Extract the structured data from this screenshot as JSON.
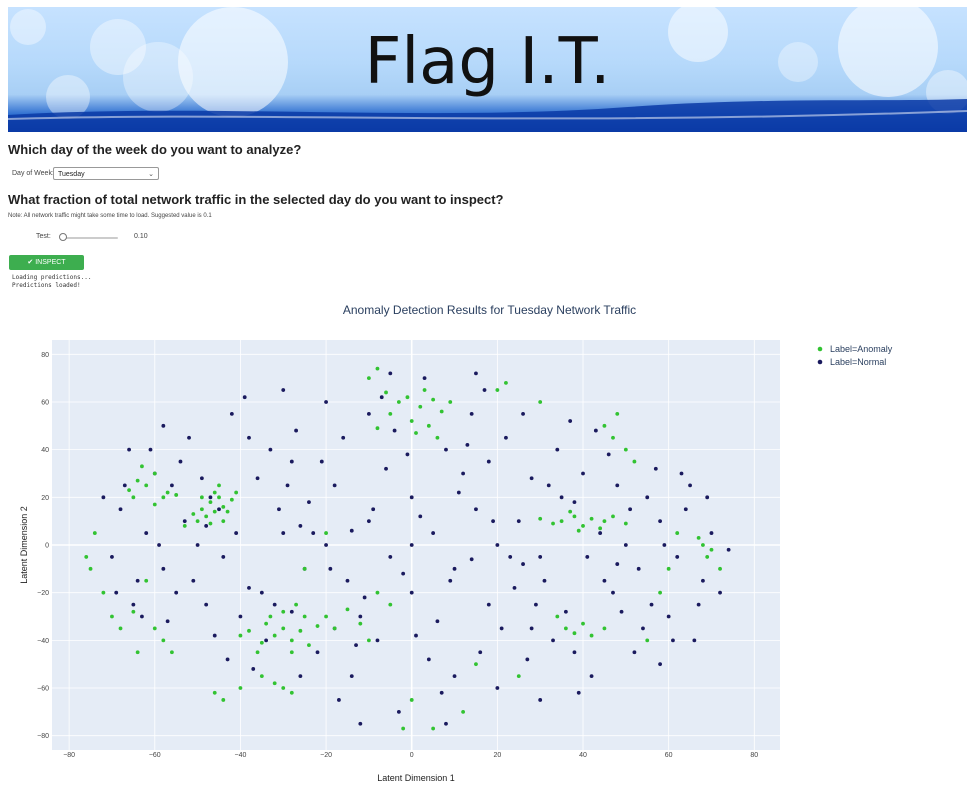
{
  "banner": {
    "title": "Flag I.T."
  },
  "form": {
    "day_question": "Which day of the week do you want to analyze?",
    "day_label": "Day of Week:",
    "day_value": "Tuesday",
    "fraction_question": "What fraction of total network traffic in the selected day do you want to inspect?",
    "note": "Note: All network traffic might take some time to load. Suggested value is 0.1",
    "slider_label": "Test:",
    "slider_value": "0.10",
    "slider_fraction": 0.1,
    "inspect_label": "INSPECT",
    "log": [
      "Loading predictions...",
      "Predictions loaded!"
    ]
  },
  "colors": {
    "anomaly": "#32c332",
    "normal": "#1a1a5e",
    "plot_bg": "#e5ecf6",
    "button": "#3dae4f"
  },
  "chart_data": {
    "type": "scatter",
    "title": "Anomaly Detection Results for Tuesday Network Traffic",
    "xlabel": "Latent Dimension 1",
    "ylabel": "Latent Dimension 2",
    "xlim": [
      -84,
      86
    ],
    "ylim": [
      -86,
      86
    ],
    "xticks": [
      "−80",
      "−60",
      "−40",
      "−20",
      "0",
      "20",
      "40",
      "60",
      "80"
    ],
    "yticks": [
      "80",
      "60",
      "40",
      "20",
      "0",
      "−20",
      "−40",
      "−60",
      "−80"
    ],
    "legend": "top-right",
    "series": [
      {
        "name": "Label=Anomaly",
        "color": "#32c332",
        "points": [
          [
            -45,
            20
          ],
          [
            -47,
            18
          ],
          [
            -49,
            15
          ],
          [
            -44,
            16
          ],
          [
            -46,
            22
          ],
          [
            -48,
            12
          ],
          [
            -50,
            10
          ],
          [
            -43,
            14
          ],
          [
            -45,
            25
          ],
          [
            -47,
            9
          ],
          [
            -51,
            13
          ],
          [
            -42,
            19
          ],
          [
            -44,
            10
          ],
          [
            -49,
            20
          ],
          [
            -46,
            14
          ],
          [
            -53,
            8
          ],
          [
            -41,
            22
          ],
          [
            -58,
            20
          ],
          [
            -60,
            17
          ],
          [
            -57,
            22
          ],
          [
            -62,
            25
          ],
          [
            -64,
            27
          ],
          [
            -60,
            30
          ],
          [
            -66,
            23
          ],
          [
            -63,
            33
          ],
          [
            -65,
            20
          ],
          [
            -55,
            21
          ],
          [
            -30,
            -35
          ],
          [
            -32,
            -38
          ],
          [
            -28,
            -40
          ],
          [
            -34,
            -33
          ],
          [
            -26,
            -36
          ],
          [
            -35,
            -41
          ],
          [
            -25,
            -30
          ],
          [
            -22,
            -34
          ],
          [
            -38,
            -36
          ],
          [
            -30,
            -28
          ],
          [
            -20,
            -30
          ],
          [
            -18,
            -35
          ],
          [
            -36,
            -45
          ],
          [
            -28,
            -45
          ],
          [
            -24,
            -42
          ],
          [
            -40,
            -38
          ],
          [
            -15,
            -27
          ],
          [
            -12,
            -33
          ],
          [
            -33,
            -30
          ],
          [
            -27,
            -25
          ],
          [
            -10,
            -40
          ],
          [
            -5,
            -25
          ],
          [
            -30,
            -60
          ],
          [
            -28,
            -62
          ],
          [
            -32,
            -58
          ],
          [
            -3,
            60
          ],
          [
            -1,
            62
          ],
          [
            2,
            58
          ],
          [
            5,
            61
          ],
          [
            -5,
            55
          ],
          [
            0,
            52
          ],
          [
            4,
            50
          ],
          [
            7,
            56
          ],
          [
            1,
            47
          ],
          [
            -6,
            64
          ],
          [
            9,
            60
          ],
          [
            3,
            65
          ],
          [
            -8,
            49
          ],
          [
            6,
            45
          ],
          [
            35,
            10
          ],
          [
            38,
            12
          ],
          [
            40,
            8
          ],
          [
            42,
            11
          ],
          [
            45,
            10
          ],
          [
            37,
            14
          ],
          [
            33,
            9
          ],
          [
            44,
            7
          ],
          [
            47,
            12
          ],
          [
            30,
            11
          ],
          [
            39,
            6
          ],
          [
            50,
            9
          ],
          [
            36,
            -35
          ],
          [
            38,
            -37
          ],
          [
            40,
            -33
          ],
          [
            42,
            -38
          ],
          [
            34,
            -30
          ],
          [
            45,
            -35
          ],
          [
            68,
            0
          ],
          [
            70,
            -2
          ],
          [
            67,
            3
          ],
          [
            69,
            -5
          ],
          [
            72,
            -10
          ],
          [
            -75,
            -10
          ],
          [
            -76,
            -5
          ],
          [
            -74,
            5
          ],
          [
            -72,
            -20
          ],
          [
            -70,
            -30
          ],
          [
            -68,
            -35
          ],
          [
            -60,
            -35
          ],
          [
            -58,
            -40
          ],
          [
            -56,
            -45
          ],
          [
            -64,
            -45
          ],
          [
            50,
            40
          ],
          [
            47,
            45
          ],
          [
            45,
            50
          ],
          [
            52,
            35
          ],
          [
            48,
            55
          ],
          [
            -10,
            70
          ],
          [
            -8,
            74
          ],
          [
            20,
            65
          ],
          [
            22,
            68
          ],
          [
            30,
            60
          ],
          [
            -44,
            -65
          ],
          [
            -46,
            -62
          ],
          [
            -2,
            -77
          ],
          [
            5,
            -77
          ],
          [
            12,
            -70
          ],
          [
            -20,
            5
          ],
          [
            -25,
            -10
          ],
          [
            -8,
            -20
          ],
          [
            15,
            -50
          ],
          [
            25,
            -55
          ],
          [
            58,
            -20
          ],
          [
            60,
            -10
          ],
          [
            62,
            5
          ],
          [
            -65,
            -28
          ],
          [
            -62,
            -15
          ],
          [
            55,
            -40
          ],
          [
            -40,
            -60
          ],
          [
            -35,
            -55
          ],
          [
            0,
            -65
          ]
        ]
      },
      {
        "name": "Label=Normal",
        "color": "#1a1a5e",
        "points": [
          [
            0,
            0
          ],
          [
            5,
            5
          ],
          [
            -5,
            -5
          ],
          [
            10,
            -10
          ],
          [
            -10,
            10
          ],
          [
            15,
            15
          ],
          [
            -15,
            -15
          ],
          [
            20,
            0
          ],
          [
            -20,
            0
          ],
          [
            0,
            20
          ],
          [
            0,
            -20
          ],
          [
            25,
            10
          ],
          [
            -25,
            -10
          ],
          [
            30,
            -5
          ],
          [
            -30,
            5
          ],
          [
            12,
            30
          ],
          [
            -12,
            -30
          ],
          [
            18,
            -25
          ],
          [
            -18,
            25
          ],
          [
            35,
            20
          ],
          [
            -35,
            -20
          ],
          [
            40,
            30
          ],
          [
            -40,
            -30
          ],
          [
            45,
            -15
          ],
          [
            -45,
            15
          ],
          [
            50,
            0
          ],
          [
            -50,
            0
          ],
          [
            55,
            20
          ],
          [
            -55,
            -20
          ],
          [
            60,
            -30
          ],
          [
            -60,
            30
          ],
          [
            8,
            40
          ],
          [
            -8,
            -40
          ],
          [
            22,
            45
          ],
          [
            -22,
            -45
          ],
          [
            28,
            -35
          ],
          [
            -28,
            35
          ],
          [
            38,
            -45
          ],
          [
            -38,
            45
          ],
          [
            48,
            25
          ],
          [
            -48,
            -25
          ],
          [
            52,
            -45
          ],
          [
            -52,
            45
          ],
          [
            58,
            10
          ],
          [
            -58,
            -10
          ],
          [
            62,
            -5
          ],
          [
            -62,
            5
          ],
          [
            65,
            25
          ],
          [
            -65,
            -25
          ],
          [
            68,
            -15
          ],
          [
            -68,
            15
          ],
          [
            3,
            70
          ],
          [
            -3,
            -70
          ],
          [
            14,
            55
          ],
          [
            -14,
            -55
          ],
          [
            26,
            55
          ],
          [
            -26,
            -55
          ],
          [
            34,
            40
          ],
          [
            -34,
            -40
          ],
          [
            42,
            -55
          ],
          [
            -42,
            55
          ],
          [
            10,
            -55
          ],
          [
            -10,
            55
          ],
          [
            20,
            -60
          ],
          [
            -20,
            60
          ],
          [
            30,
            -65
          ],
          [
            -30,
            65
          ],
          [
            16,
            -45
          ],
          [
            -16,
            45
          ],
          [
            6,
            -32
          ],
          [
            -6,
            32
          ],
          [
            24,
            -18
          ],
          [
            -24,
            18
          ],
          [
            32,
            25
          ],
          [
            -32,
            -25
          ],
          [
            44,
            5
          ],
          [
            -44,
            -5
          ],
          [
            54,
            -35
          ],
          [
            -54,
            35
          ],
          [
            64,
            15
          ],
          [
            -64,
            -15
          ],
          [
            70,
            5
          ],
          [
            -70,
            -5
          ],
          [
            72,
            -20
          ],
          [
            -72,
            20
          ],
          [
            2,
            12
          ],
          [
            -2,
            -12
          ],
          [
            14,
            -6
          ],
          [
            -14,
            6
          ],
          [
            26,
            -8
          ],
          [
            -26,
            8
          ],
          [
            36,
            -28
          ],
          [
            -36,
            28
          ],
          [
            46,
            38
          ],
          [
            -46,
            -38
          ],
          [
            56,
            -25
          ],
          [
            -56,
            25
          ],
          [
            66,
            -40
          ],
          [
            -66,
            40
          ],
          [
            74,
            -2
          ],
          [
            4,
            -48
          ],
          [
            -4,
            48
          ],
          [
            18,
            35
          ],
          [
            -18,
            -35
          ],
          [
            28,
            28
          ],
          [
            -28,
            -28
          ],
          [
            38,
            18
          ],
          [
            -38,
            -18
          ],
          [
            48,
            -8
          ],
          [
            -48,
            8
          ],
          [
            58,
            -50
          ],
          [
            -58,
            50
          ],
          [
            7,
            -62
          ],
          [
            -7,
            62
          ],
          [
            17,
            65
          ],
          [
            -17,
            -65
          ],
          [
            27,
            -48
          ],
          [
            -27,
            48
          ],
          [
            37,
            52
          ],
          [
            -37,
            -52
          ],
          [
            47,
            -20
          ],
          [
            -47,
            20
          ],
          [
            57,
            32
          ],
          [
            -57,
            -32
          ],
          [
            67,
            -25
          ],
          [
            -67,
            25
          ],
          [
            11,
            22
          ],
          [
            -11,
            -22
          ],
          [
            21,
            -35
          ],
          [
            -21,
            35
          ],
          [
            31,
            -15
          ],
          [
            -31,
            15
          ],
          [
            41,
            -5
          ],
          [
            -41,
            5
          ],
          [
            51,
            15
          ],
          [
            -51,
            -15
          ],
          [
            61,
            -40
          ],
          [
            -61,
            40
          ],
          [
            1,
            -38
          ],
          [
            -1,
            38
          ],
          [
            13,
            42
          ],
          [
            -13,
            -42
          ],
          [
            23,
            -5
          ],
          [
            -23,
            5
          ],
          [
            33,
            -40
          ],
          [
            -33,
            40
          ],
          [
            43,
            48
          ],
          [
            -43,
            -48
          ],
          [
            53,
            -10
          ],
          [
            -53,
            10
          ],
          [
            63,
            30
          ],
          [
            -63,
            -30
          ],
          [
            9,
            -15
          ],
          [
            -9,
            15
          ],
          [
            19,
            10
          ],
          [
            -19,
            -10
          ],
          [
            29,
            -25
          ],
          [
            -29,
            25
          ],
          [
            39,
            -62
          ],
          [
            -39,
            62
          ],
          [
            49,
            -28
          ],
          [
            -49,
            28
          ],
          [
            59,
            0
          ],
          [
            -59,
            0
          ],
          [
            69,
            20
          ],
          [
            -69,
            -20
          ],
          [
            -12,
            -75
          ],
          [
            8,
            -75
          ],
          [
            -5,
            72
          ],
          [
            15,
            72
          ]
        ]
      }
    ]
  }
}
